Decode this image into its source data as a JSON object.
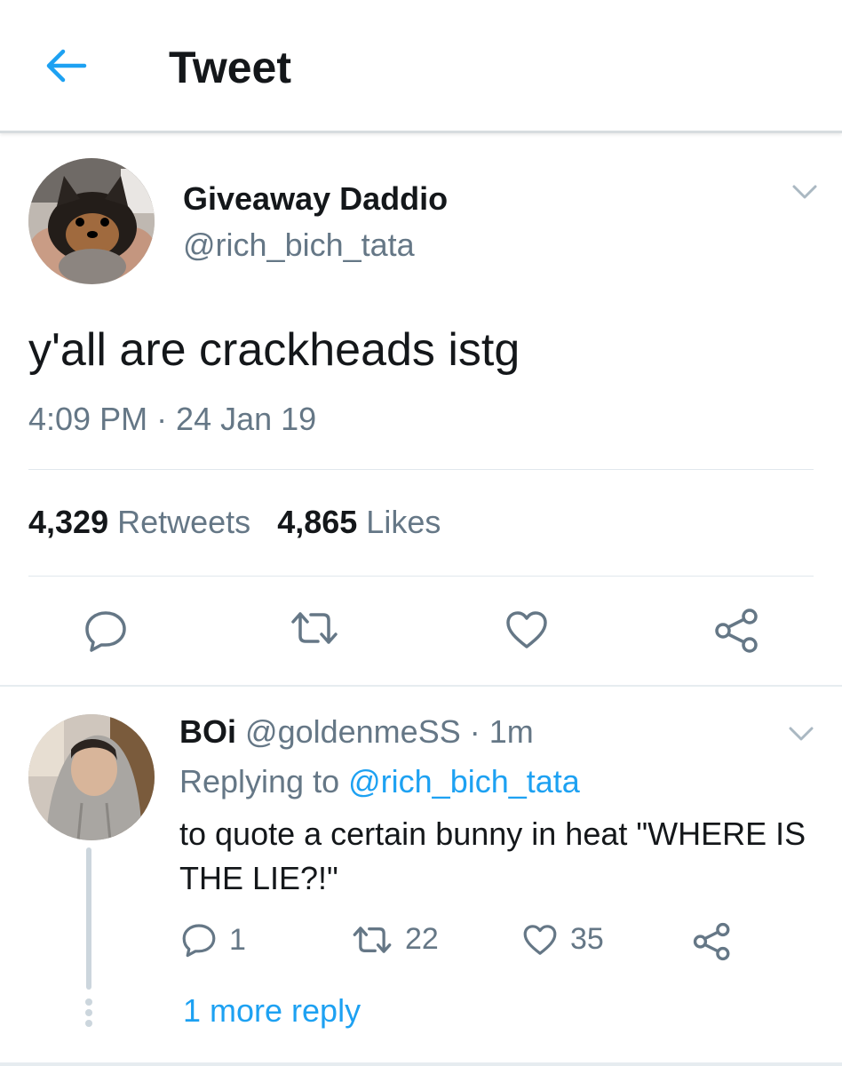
{
  "header": {
    "title": "Tweet",
    "back_icon": "arrow-left-icon"
  },
  "tweet": {
    "author_name": "Giveaway Daddio",
    "author_handle": "@rich_bich_tata",
    "text": "y'all are crackheads istg",
    "timestamp": "4:09 PM · 24 Jan 19",
    "retweets_count": "4,329",
    "retweets_label": "Retweets",
    "likes_count": "4,865",
    "likes_label": "Likes",
    "actions": [
      "reply-icon",
      "retweet-icon",
      "like-icon",
      "share-icon"
    ]
  },
  "reply": {
    "author_name": "BOi",
    "author_handle": "@goldenmeSS",
    "time": "· 1m",
    "replying_label": "Replying to",
    "replying_to": "@rich_bich_tata",
    "text": "to quote a certain bunny in heat \"WHERE IS THE LIE?!\"",
    "reply_count": "1",
    "retweet_count": "22",
    "like_count": "35",
    "more_replies": "1 more reply"
  },
  "colors": {
    "accent": "#1da1f2",
    "secondary_text": "#657786",
    "primary_text": "#14171a",
    "divider": "#e1e8ed"
  }
}
